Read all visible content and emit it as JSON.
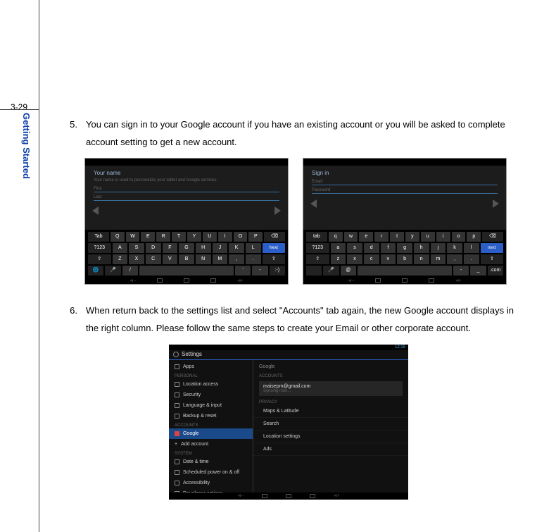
{
  "page_number": "3-29",
  "side_tab": "Getting Started",
  "step5": {
    "num": "5.",
    "text": "You can sign in to your Google account if you have an existing account or you will be asked to complete account setting to get a new account."
  },
  "step6": {
    "num": "6.",
    "text": "When return back to the settings list and select \"Accounts\" tab again, the new Google account displays in the right column. Please follow the same steps to create your Email or other corporate account."
  },
  "shot1": {
    "title": "Your name",
    "subtitle": "Your name is used to personalize your tablet and Google services.",
    "field1": "First",
    "field2": "Last",
    "tab_key": "Tab",
    "sym_key": "?123",
    "next_key": "Next",
    "row1": [
      "Q",
      "W",
      "E",
      "R",
      "T",
      "Y",
      "U",
      "I",
      "O",
      "P"
    ],
    "row2": [
      "A",
      "S",
      "D",
      "F",
      "G",
      "H",
      "J",
      "K",
      "L"
    ],
    "row3": [
      "Z",
      "X",
      "C",
      "V",
      "B",
      "N",
      "M",
      ",",
      "."
    ],
    "row4_slash": "/",
    "row4_apos": "'",
    "row4_dash": "-",
    "row4_smile": ":-)",
    "bksp": "⌫",
    "shift": "⇧",
    "globe": "🌐",
    "mic": "🎤"
  },
  "shot2": {
    "title": "Sign in",
    "field1": "Email",
    "field2": "Password",
    "tab_key": "Tab",
    "sym_key": "?123",
    "next_key": "Next",
    "row1": [
      "q",
      "w",
      "e",
      "r",
      "t",
      "y",
      "u",
      "i",
      "o",
      "p"
    ],
    "row2": [
      "a",
      "s",
      "d",
      "f",
      "g",
      "h",
      "j",
      "k",
      "l"
    ],
    "row3": [
      "z",
      "x",
      "c",
      "v",
      "b",
      "n",
      "m",
      ",",
      "."
    ],
    "at_key": "@",
    "dash_key": "-",
    "underscore_key": "_",
    "com_key": ".com",
    "bksp": "⌫",
    "shift": "⇧",
    "mic": "🎤"
  },
  "shot3": {
    "time": "12:15",
    "title": "Settings",
    "left": {
      "apps": "Apps",
      "hdr_personal": "PERSONAL",
      "loc": "Location access",
      "sec": "Security",
      "lang": "Language & input",
      "backup": "Backup & reset",
      "hdr_accounts": "ACCOUNTS",
      "google": "Google",
      "add": "Add account",
      "hdr_system": "SYSTEM",
      "date": "Date & time",
      "sched": "Scheduled power on & off",
      "access": "Accessibility",
      "dev": "Developer options"
    },
    "right": {
      "title": "Google",
      "hdr_accounts": "ACCOUNTS",
      "email": "maisepm@gmail.com",
      "sync": "Syncing now…",
      "hdr_privacy": "PRIVACY",
      "maps": "Maps & Latitude",
      "search": "Search",
      "locset": "Location settings",
      "ads": "Ads"
    }
  }
}
